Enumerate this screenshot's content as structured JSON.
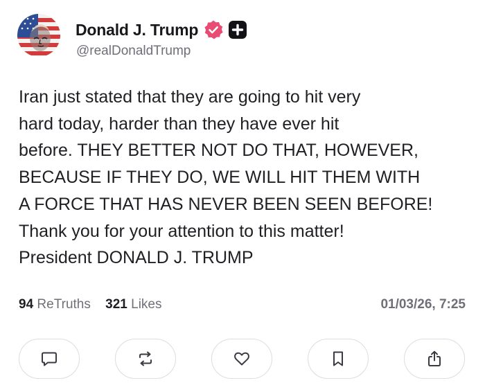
{
  "post": {
    "author": {
      "display_name": "Donald J. Trump",
      "handle": "@realDonaldTrump",
      "avatar_icon": "flag-portrait-avatar",
      "verified_icon": "verified-badge-icon",
      "plus_icon": "plus-badge-icon"
    },
    "text_lines": [
      "Iran just stated that they are going to hit very",
      "hard today, harder than they have ever hit",
      "before. THEY BETTER NOT DO THAT, HOWEVER,",
      "BECAUSE IF THEY DO, WE WILL HIT THEM WITH",
      "A FORCE THAT HAS NEVER BEEN SEEN BEFORE!",
      "Thank you for your attention to this matter!",
      "President DONALD J. TRUMP"
    ],
    "stats": {
      "retruths_count": "94",
      "retruths_label": "ReTruths",
      "likes_count": "321",
      "likes_label": "Likes"
    },
    "timestamp": "01/03/26, 7:25"
  },
  "actions": [
    {
      "name": "reply",
      "icon": "comment-icon"
    },
    {
      "name": "retruth",
      "icon": "repost-icon"
    },
    {
      "name": "like",
      "icon": "heart-icon"
    },
    {
      "name": "bookmark",
      "icon": "bookmark-icon"
    },
    {
      "name": "share",
      "icon": "share-icon"
    }
  ],
  "colors": {
    "verified_badge": "#E84C73",
    "plus_badge": "#121217",
    "secondary_text": "#6F6F78",
    "button_border": "#DCDCE3",
    "icon_stroke": "#3A3A42"
  }
}
